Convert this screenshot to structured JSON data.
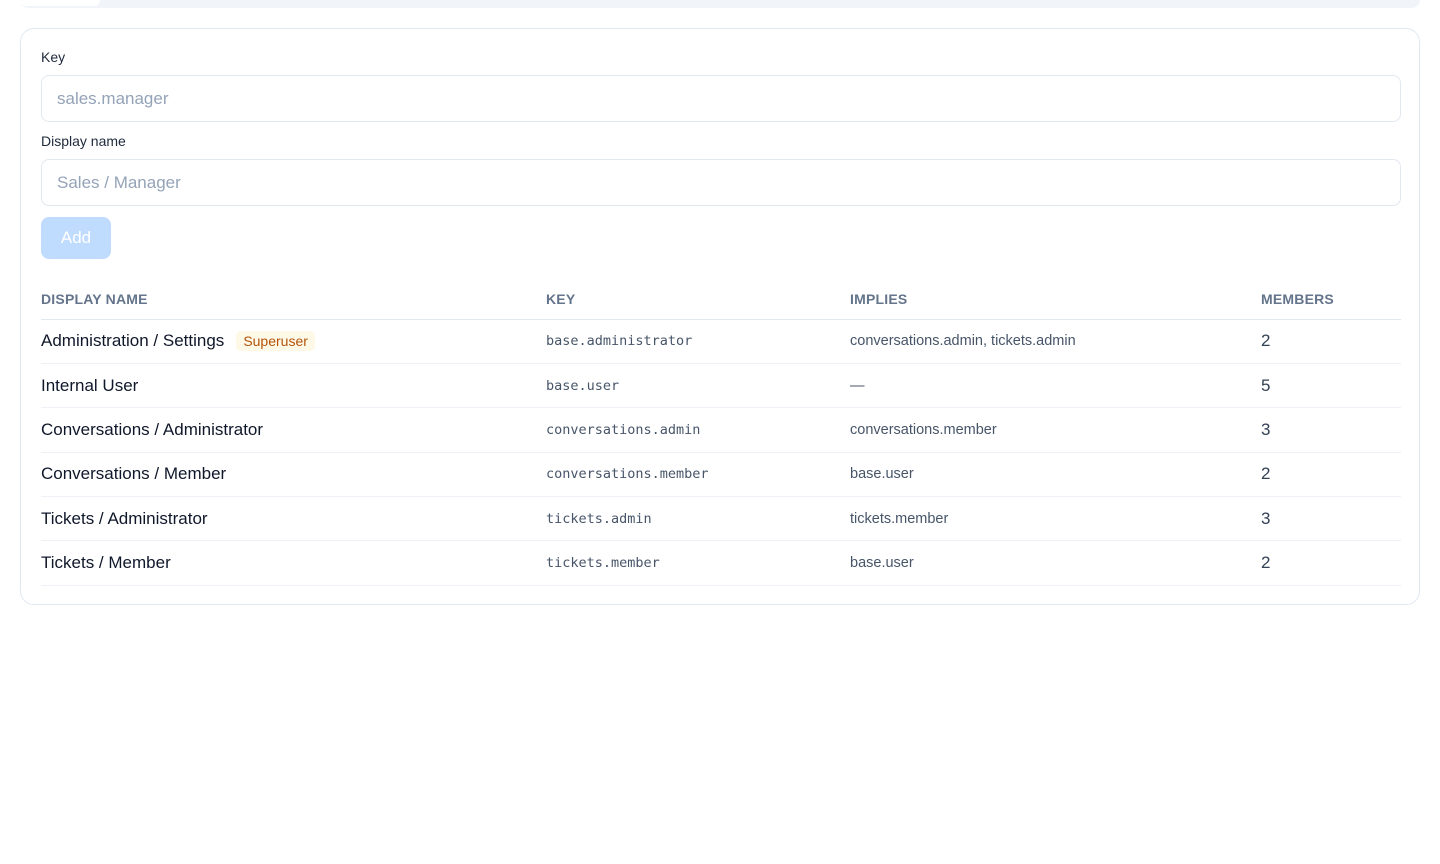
{
  "form": {
    "key_label": "Key",
    "key_placeholder": "sales.manager",
    "display_name_label": "Display name",
    "display_name_placeholder": "Sales / Manager",
    "add_label": "Add"
  },
  "table": {
    "headers": {
      "display_name": "DISPLAY NAME",
      "key": "KEY",
      "implies": "IMPLIES",
      "members": "MEMBERS"
    },
    "rows": [
      {
        "display_name": "Administration / Settings",
        "badge": "Superuser",
        "key": "base.administrator",
        "implies": "conversations.admin, tickets.admin",
        "members": "2"
      },
      {
        "display_name": "Internal User",
        "badge": "",
        "key": "base.user",
        "implies": "—",
        "members": "5"
      },
      {
        "display_name": "Conversations / Administrator",
        "badge": "",
        "key": "conversations.admin",
        "implies": "conversations.member",
        "members": "3"
      },
      {
        "display_name": "Conversations / Member",
        "badge": "",
        "key": "conversations.member",
        "implies": "base.user",
        "members": "2"
      },
      {
        "display_name": "Tickets / Administrator",
        "badge": "",
        "key": "tickets.admin",
        "implies": "tickets.member",
        "members": "3"
      },
      {
        "display_name": "Tickets / Member",
        "badge": "",
        "key": "tickets.member",
        "implies": "base.user",
        "members": "2"
      }
    ]
  },
  "colors": {
    "accent_disabled": "#bfdbfe",
    "badge_text": "#b45309",
    "badge_bg": "#fef9e7",
    "border": "#e2e8f0"
  }
}
